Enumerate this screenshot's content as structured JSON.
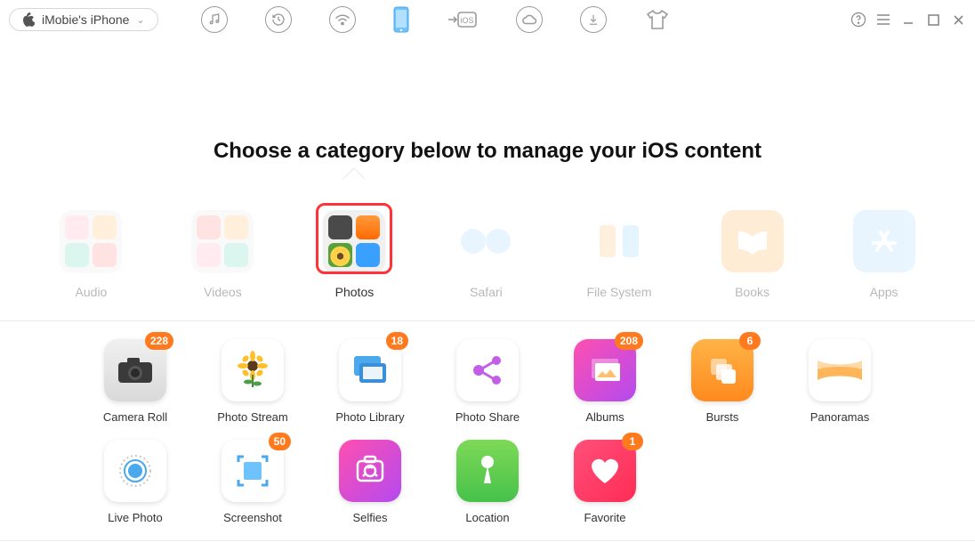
{
  "device": {
    "name": "iMobie's iPhone"
  },
  "heading": "Choose a category below to manage your iOS content",
  "categories": [
    {
      "id": "audio",
      "label": "Audio"
    },
    {
      "id": "videos",
      "label": "Videos"
    },
    {
      "id": "photos",
      "label": "Photos",
      "active": true
    },
    {
      "id": "safari",
      "label": "Safari"
    },
    {
      "id": "filesystem",
      "label": "File System"
    },
    {
      "id": "books",
      "label": "Books"
    },
    {
      "id": "apps",
      "label": "Apps"
    }
  ],
  "subcats": [
    {
      "id": "camera-roll",
      "label": "Camera Roll",
      "badge": 228
    },
    {
      "id": "photo-stream",
      "label": "Photo Stream"
    },
    {
      "id": "photo-library",
      "label": "Photo Library",
      "badge": 18
    },
    {
      "id": "photo-share",
      "label": "Photo Share"
    },
    {
      "id": "albums",
      "label": "Albums",
      "badge": 208
    },
    {
      "id": "bursts",
      "label": "Bursts",
      "badge": 6
    },
    {
      "id": "panoramas",
      "label": "Panoramas"
    },
    {
      "id": "live-photo",
      "label": "Live Photo"
    },
    {
      "id": "screenshot",
      "label": "Screenshot",
      "badge": 50
    },
    {
      "id": "selfies",
      "label": "Selfies"
    },
    {
      "id": "location",
      "label": "Location"
    },
    {
      "id": "favorite",
      "label": "Favorite",
      "badge": 1
    }
  ]
}
